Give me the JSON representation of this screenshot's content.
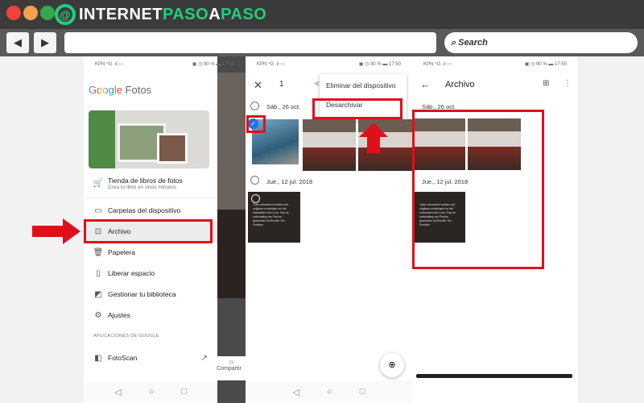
{
  "browser": {
    "logo_text_white": "INTERNET",
    "logo_text_green1": "PASO",
    "logo_text_white2": "A",
    "logo_text_green2": "PASO",
    "back": "◀",
    "forward": "▶",
    "search_label": "Search"
  },
  "status": {
    "left": "KPN ⁴G .ıl ▭",
    "right": "▣ ◷ 90 % ▬ 17:50"
  },
  "drawer": {
    "brand": "Google",
    "brand_suffix": "Fotos",
    "store_title": "Tienda de libros de fotos",
    "store_sub": "Crea tu libro en unos minutos",
    "items": [
      {
        "icon": "folder-icon",
        "glyph": "▭",
        "label": "Carpetas del dispositivo"
      },
      {
        "icon": "archive-icon",
        "glyph": "⊡",
        "label": "Archivo"
      },
      {
        "icon": "trash-icon",
        "glyph": "🗑",
        "label": "Papelera"
      },
      {
        "icon": "free-space-icon",
        "glyph": "▯",
        "label": "Liberar espacio"
      },
      {
        "icon": "library-icon",
        "glyph": "◩",
        "label": "Gestionar tu biblioteca"
      },
      {
        "icon": "settings-icon",
        "glyph": "⚙",
        "label": "Ajustes"
      }
    ],
    "section": "APLICACIONES DE GOOGLE",
    "app": "FotoScan",
    "share_label": "Compartir"
  },
  "selection": {
    "count": "1",
    "menu": [
      "Eliminar del dispositivo",
      "Desarchivar"
    ],
    "date1": "Sáb., 26 oct.",
    "date2": "Jue., 12 jul. 2018"
  },
  "archive": {
    "title": "Archivo",
    "date1": "Sáb., 26 oct.",
    "date2": "Jue., 12 jul. 2018"
  },
  "doc_text": "Twee ontroerend weken met volgbare ervaringen en het ontmoeten met Loes. Pap de ontmoeting van Paulus, gewonden bij Rocolin Ten Poortjes",
  "colors": {
    "highlight": "#e0101a",
    "accent": "#1a73e8",
    "green": "#1ed07a"
  }
}
